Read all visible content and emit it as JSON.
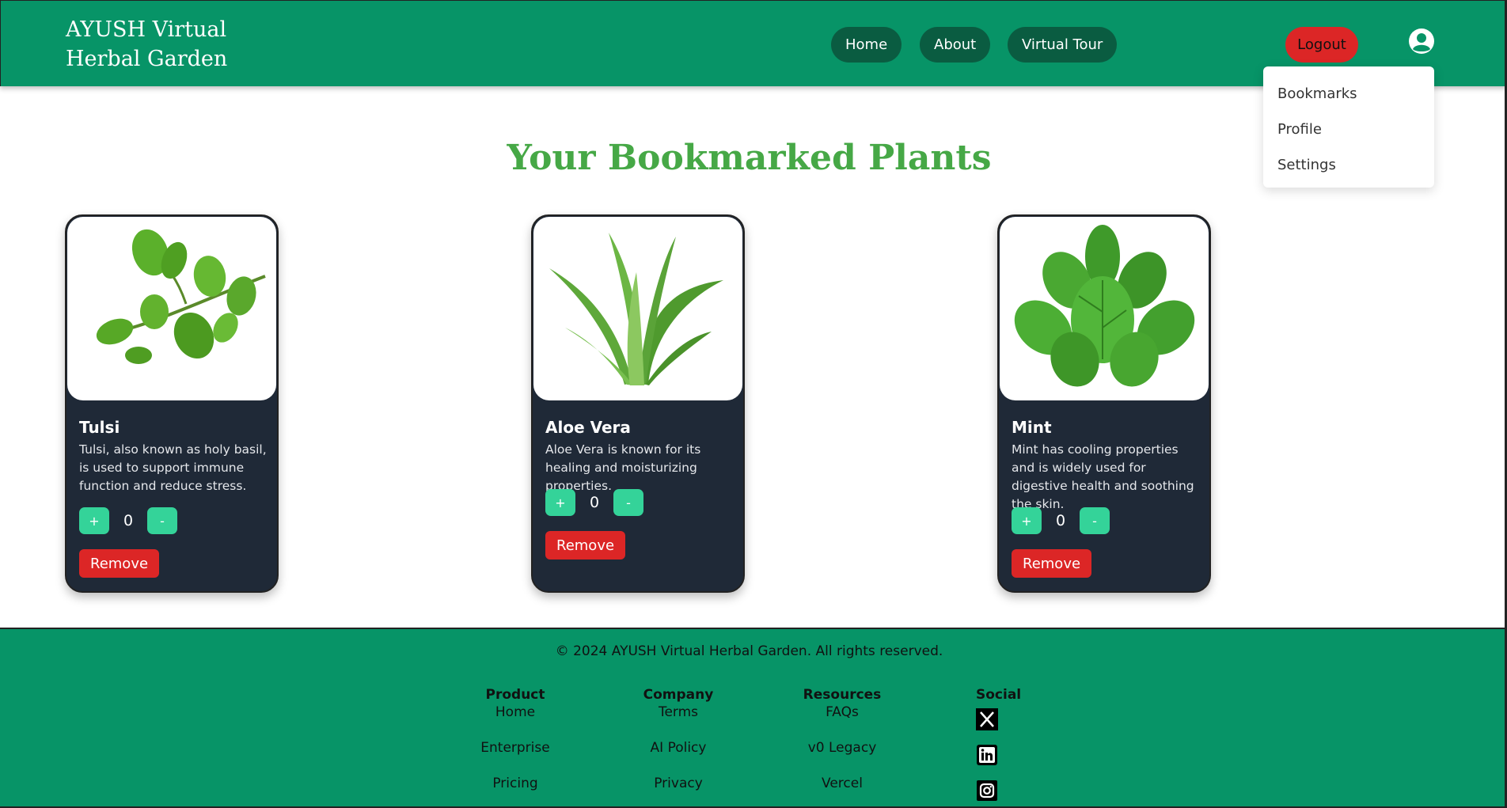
{
  "header": {
    "brand": "AYUSH Virtual Herbal Garden",
    "nav": [
      "Home",
      "About",
      "Virtual Tour"
    ],
    "logout_label": "Logout",
    "user_icon": "user-circle-icon"
  },
  "dropdown": {
    "items": [
      "Bookmarks",
      "Profile",
      "Settings"
    ]
  },
  "page_title": "Your Bookmarked Plants",
  "cards": [
    {
      "name": "Tulsi",
      "description": "Tulsi, also known as holy basil, is used to support immune function and reduce stress.",
      "count": "0",
      "plus": "+",
      "minus": "-",
      "remove": "Remove"
    },
    {
      "name": "Aloe Vera",
      "description": "Aloe Vera is known for its healing and moisturizing properties.",
      "count": "0",
      "plus": "+",
      "minus": "-",
      "remove": "Remove"
    },
    {
      "name": "Mint",
      "description": "Mint has cooling properties and is widely used for digestive health and soothing the skin.",
      "count": "0",
      "plus": "+",
      "minus": "-",
      "remove": "Remove"
    }
  ],
  "footer": {
    "copyright": "© 2024 AYUSH Virtual Herbal Garden. All rights reserved.",
    "columns": [
      {
        "title": "Product",
        "links": [
          "Home",
          "Enterprise",
          "Pricing"
        ]
      },
      {
        "title": "Company",
        "links": [
          "Terms",
          "AI Policy",
          "Privacy"
        ]
      },
      {
        "title": "Resources",
        "links": [
          "FAQs",
          "v0 Legacy",
          "Vercel"
        ]
      }
    ],
    "social": {
      "title": "Social",
      "icons": [
        "x-icon",
        "linkedin-icon",
        "instagram-icon"
      ]
    }
  },
  "colors": {
    "brand_green": "#079467",
    "nav_pill": "#0a5c41",
    "danger": "#dc2626",
    "card_bg": "#1f2937",
    "stepper": "#34d399",
    "title_green": "#46a846"
  }
}
